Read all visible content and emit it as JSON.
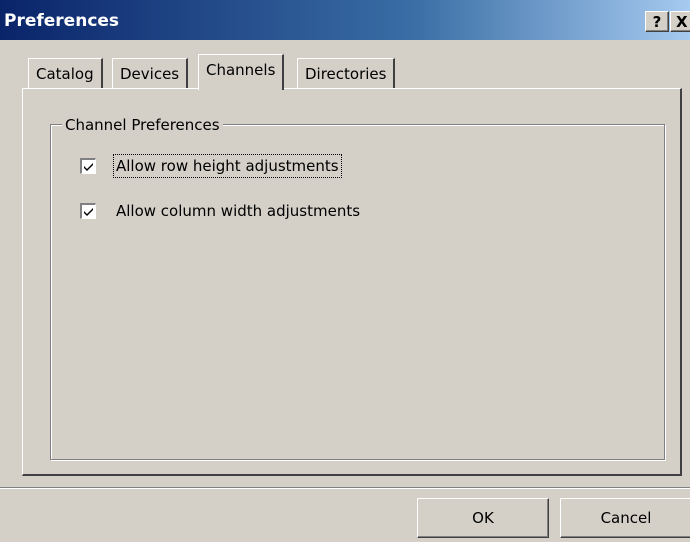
{
  "window": {
    "title": "Preferences",
    "help_label": "?",
    "close_label": "X"
  },
  "tabs": [
    {
      "label": "Catalog",
      "active": false
    },
    {
      "label": "Devices",
      "active": false
    },
    {
      "label": "Channels",
      "active": true
    },
    {
      "label": "Directories",
      "active": false
    }
  ],
  "group": {
    "title": "Channel Preferences",
    "options": [
      {
        "label": "Allow row height adjustments",
        "checked": true,
        "focused": true
      },
      {
        "label": "Allow column width adjustments",
        "checked": true,
        "focused": false
      }
    ]
  },
  "buttons": {
    "ok": "OK",
    "cancel": "Cancel"
  },
  "colors": {
    "face": "#d4d0c8",
    "title_start": "#0a246a",
    "title_end": "#a6caf0"
  }
}
